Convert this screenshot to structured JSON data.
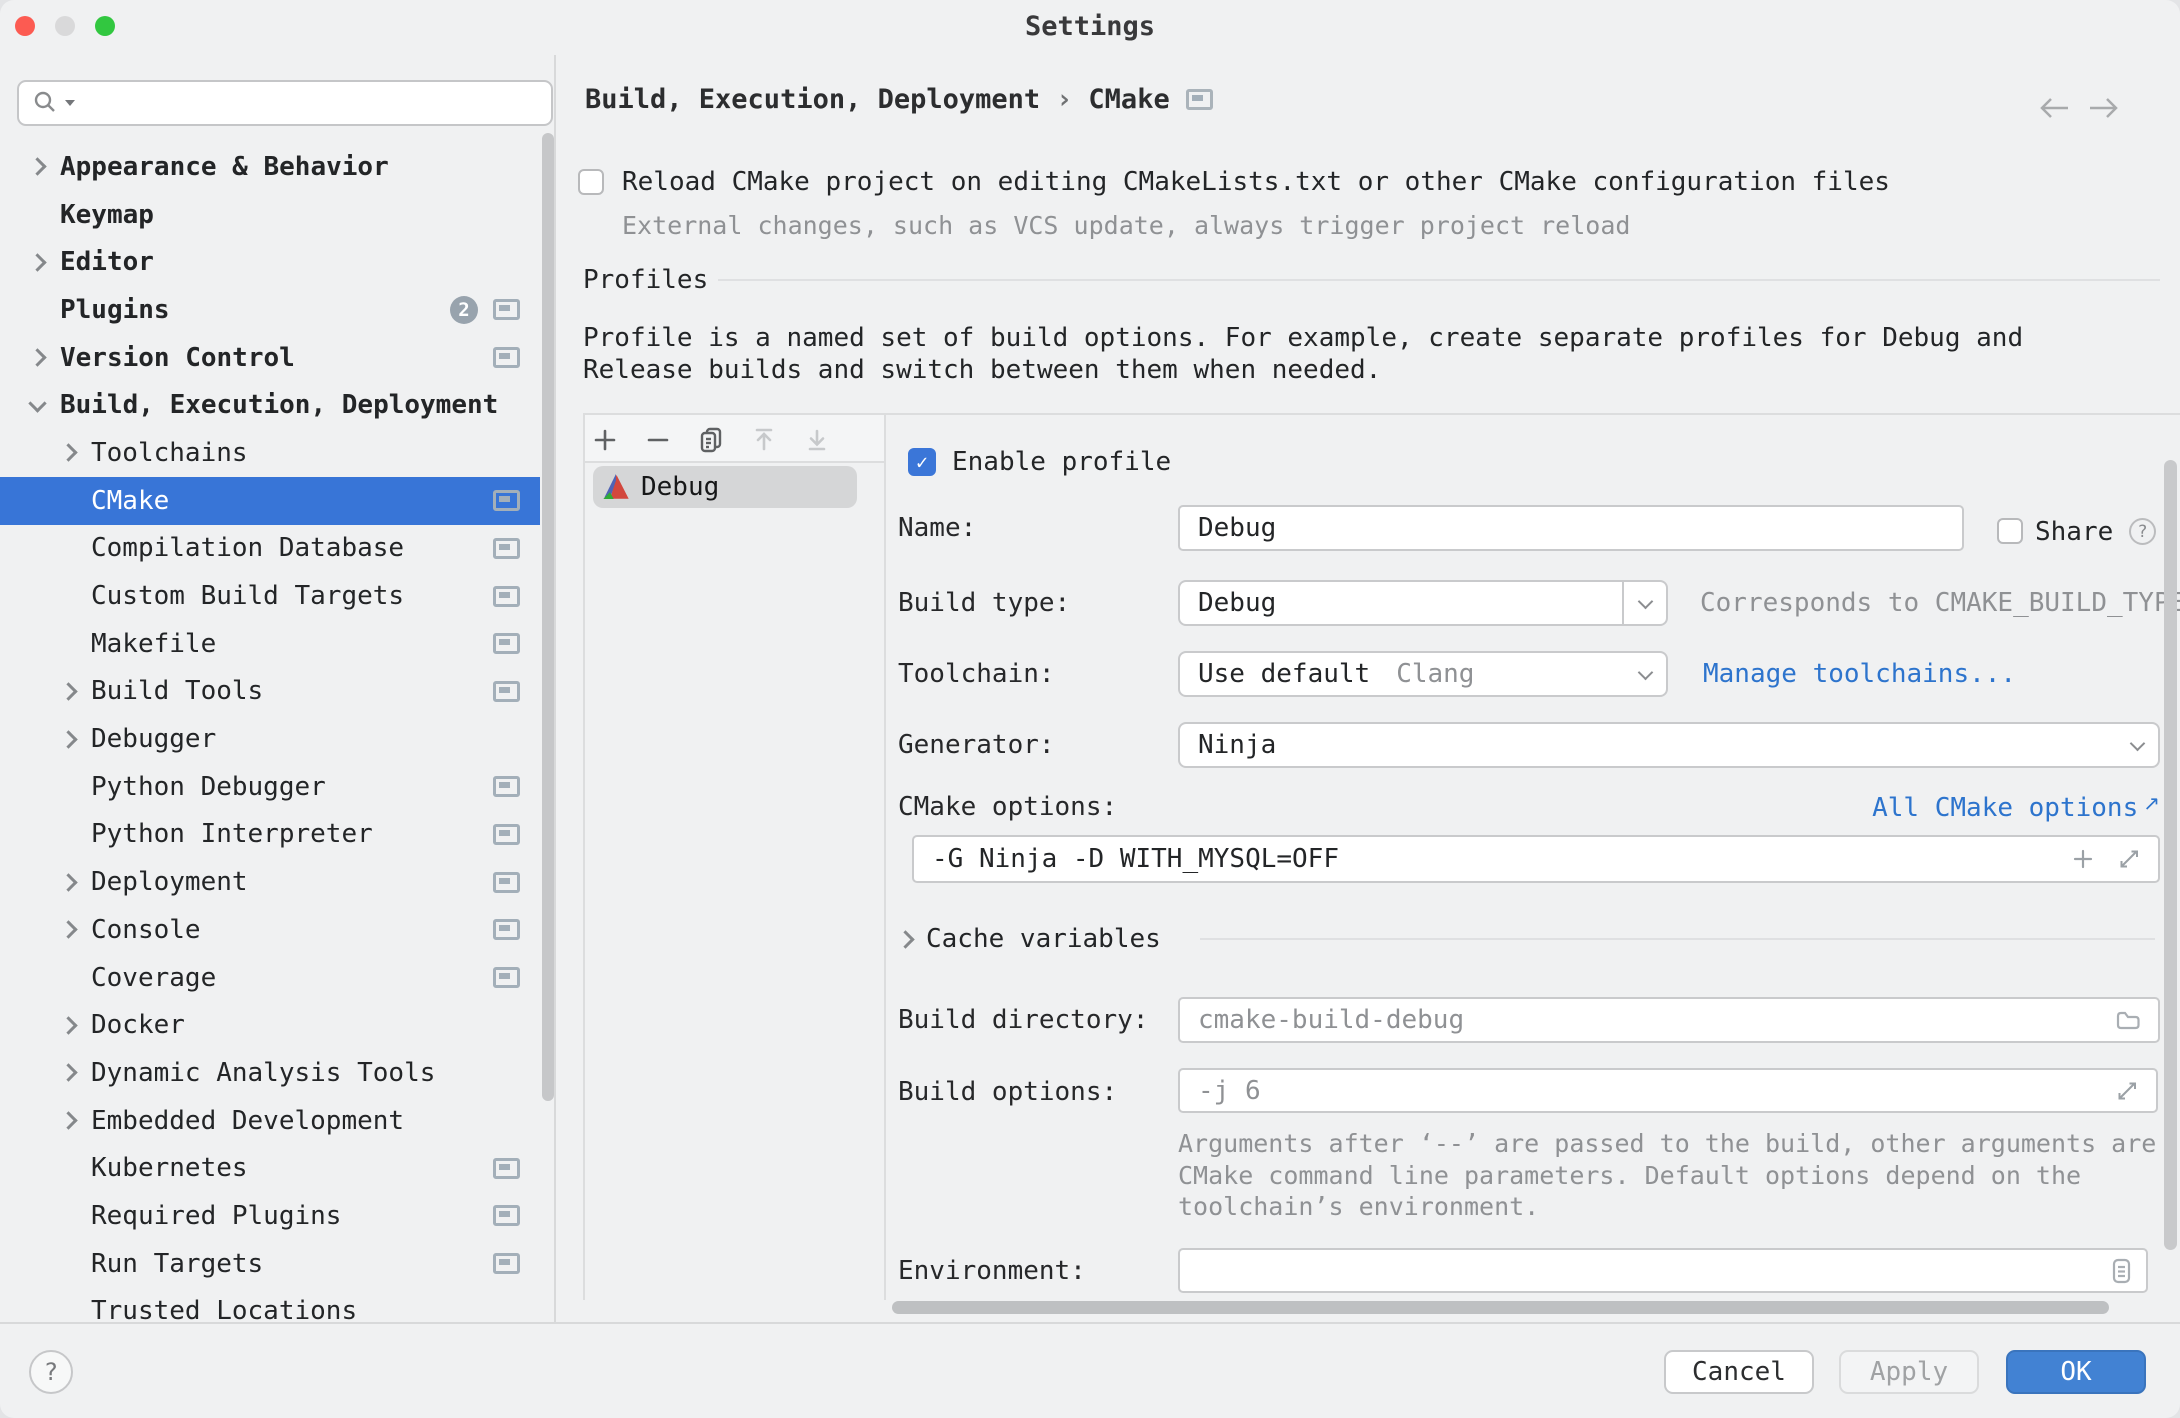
{
  "window": {
    "title": "Settings"
  },
  "search": {
    "value": ""
  },
  "sidebar": {
    "items": [
      {
        "label": "Appearance & Behavior",
        "level": 1,
        "bold": true,
        "chevron": "right"
      },
      {
        "label": "Keymap",
        "level": 1,
        "bold": true
      },
      {
        "label": "Editor",
        "level": 1,
        "bold": true,
        "chevron": "right"
      },
      {
        "label": "Plugins",
        "level": 1,
        "bold": true,
        "badge": "2",
        "screen_icon": true
      },
      {
        "label": "Version Control",
        "level": 1,
        "bold": true,
        "chevron": "right",
        "screen_icon": true
      },
      {
        "label": "Build, Execution, Deployment",
        "level": 1,
        "bold": true,
        "chevron": "down"
      },
      {
        "label": "Toolchains",
        "level": 2,
        "chevron": "right"
      },
      {
        "label": "CMake",
        "level": 2,
        "selected": true,
        "screen_icon": true
      },
      {
        "label": "Compilation Database",
        "level": 2,
        "screen_icon": true
      },
      {
        "label": "Custom Build Targets",
        "level": 2,
        "screen_icon": true
      },
      {
        "label": "Makefile",
        "level": 2,
        "screen_icon": true
      },
      {
        "label": "Build Tools",
        "level": 2,
        "chevron": "right",
        "screen_icon": true
      },
      {
        "label": "Debugger",
        "level": 2,
        "chevron": "right"
      },
      {
        "label": "Python Debugger",
        "level": 2,
        "screen_icon": true
      },
      {
        "label": "Python Interpreter",
        "level": 2,
        "screen_icon": true
      },
      {
        "label": "Deployment",
        "level": 2,
        "chevron": "right",
        "screen_icon": true
      },
      {
        "label": "Console",
        "level": 2,
        "chevron": "right",
        "screen_icon": true
      },
      {
        "label": "Coverage",
        "level": 2,
        "screen_icon": true
      },
      {
        "label": "Docker",
        "level": 2,
        "chevron": "right"
      },
      {
        "label": "Dynamic Analysis Tools",
        "level": 2,
        "chevron": "right"
      },
      {
        "label": "Embedded Development",
        "level": 2,
        "chevron": "right"
      },
      {
        "label": "Kubernetes",
        "level": 2,
        "screen_icon": true
      },
      {
        "label": "Required Plugins",
        "level": 2,
        "screen_icon": true
      },
      {
        "label": "Run Targets",
        "level": 2,
        "screen_icon": true
      },
      {
        "label": "Trusted Locations",
        "level": 2
      }
    ]
  },
  "breadcrumb": {
    "path": "Build, Execution, Deployment",
    "separator": "›",
    "current": "CMake"
  },
  "reload": {
    "label": "Reload CMake project on editing CMakeLists.txt or other CMake configuration files",
    "hint": "External changes, such as VCS update, always trigger project reload",
    "checked": false
  },
  "profiles": {
    "header": "Profiles",
    "description_line1": "Profile is a named set of build options. For example, create separate profiles for Debug and",
    "description_line2": "Release builds and switch between them when needed.",
    "list": [
      {
        "name": "Debug"
      }
    ]
  },
  "form": {
    "enable_profile": {
      "label": "Enable profile",
      "checked": true
    },
    "name": {
      "label": "Name:",
      "value": "Debug"
    },
    "share": {
      "label": "Share",
      "checked": false,
      "help": "?"
    },
    "build_type": {
      "label": "Build type:",
      "value": "Debug",
      "note": "Corresponds to CMAKE_BUILD_TYPE"
    },
    "toolchain": {
      "label": "Toolchain:",
      "value": "Use default",
      "detail": "Clang",
      "link": "Manage toolchains..."
    },
    "generator": {
      "label": "Generator:",
      "value": "Ninja"
    },
    "cmake_options": {
      "label": "CMake options:",
      "link": "All CMake options",
      "link_arrow": "↗",
      "value": "-G Ninja -D WITH_MYSQL=OFF"
    },
    "cache_variables": {
      "label": "Cache variables"
    },
    "build_directory": {
      "label": "Build directory:",
      "placeholder": "cmake-build-debug"
    },
    "build_options": {
      "label": "Build options:",
      "placeholder": "-j 6",
      "hint_line1": "Arguments after ‘--’ are passed to the build, other arguments are",
      "hint_line2": "CMake command line parameters. Default options depend on the",
      "hint_line3": "toolchain’s environment."
    },
    "environment": {
      "label": "Environment:",
      "value": ""
    }
  },
  "footer": {
    "help": "?",
    "cancel": "Cancel",
    "apply": "Apply",
    "ok": "OK"
  },
  "colors": {
    "selection_blue": "#3875d7",
    "checkbox_blue": "#3b76d8",
    "link_blue": "#2d74cd",
    "ok_button_blue": "#4282d3",
    "traffic_red": "#fc5b52",
    "traffic_green": "#32c740",
    "background": "#f0f1f2"
  }
}
